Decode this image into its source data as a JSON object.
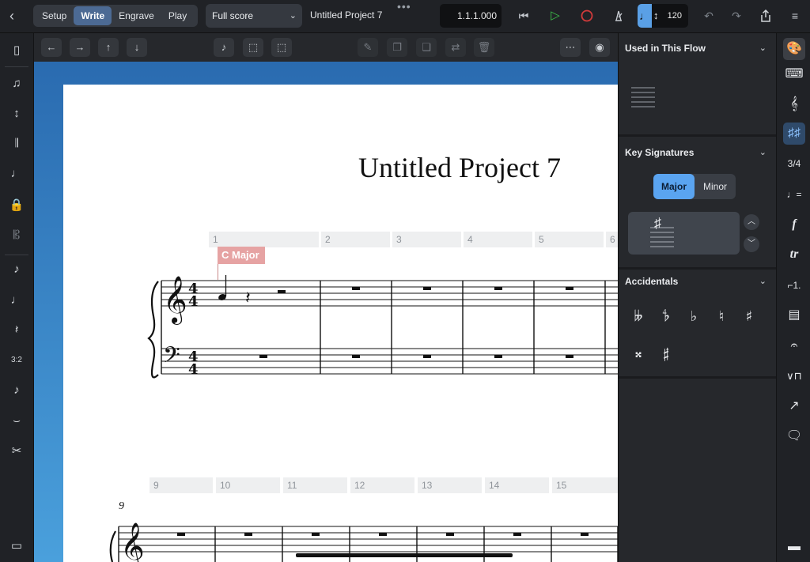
{
  "topbar": {
    "back_icon": "back-chevron-icon",
    "modes": [
      "Setup",
      "Write",
      "Engrave",
      "Play"
    ],
    "active_mode": "Write",
    "layout_select": "Full score",
    "doc_title": "Untitled Project 7",
    "position": "1.1.1.000",
    "tempo": "120"
  },
  "score": {
    "title": "Untitled Project 7",
    "key_signpost": "C Major",
    "bar_numbers_row1": [
      "1",
      "2",
      "3",
      "4",
      "5",
      "6"
    ],
    "bar_numbers_row2": [
      "9",
      "10",
      "11",
      "12",
      "13",
      "14",
      "15"
    ],
    "system_number": "9",
    "time_signature": "4/4"
  },
  "panel": {
    "used_in_flow": "Used in This Flow",
    "key_signatures": "Key Signatures",
    "major": "Major",
    "minor": "Minor",
    "accidentals": "Accidentals",
    "accidental_symbols": [
      "𝄫",
      "𝄳",
      "♭",
      "♮",
      "♯",
      "𝄪",
      "𝄰"
    ],
    "key_preview_symbol": "♯"
  },
  "colors": {
    "accent": "#5aa4f0",
    "active_mode": "#4c6a94",
    "signpost": "#e6a3a3",
    "record": "#d23b3b",
    "play": "#3cc04a"
  }
}
